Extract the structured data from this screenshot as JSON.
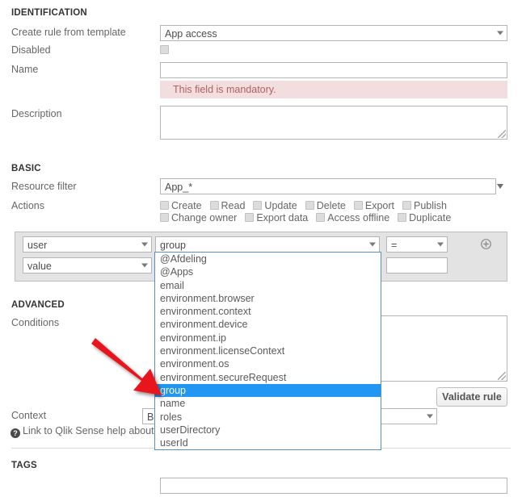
{
  "sections": {
    "identification": "IDENTIFICATION",
    "basic": "BASIC",
    "advanced": "ADVANCED",
    "tags": "TAGS"
  },
  "identification": {
    "template_label": "Create rule from template",
    "template_value": "App access",
    "disabled_label": "Disabled",
    "disabled_checked": false,
    "name_label": "Name",
    "name_value": "",
    "name_error": "This field is mandatory.",
    "description_label": "Description",
    "description_value": ""
  },
  "basic": {
    "resource_filter_label": "Resource filter",
    "resource_filter_value": "App_*",
    "actions_label": "Actions",
    "actions": [
      {
        "label": "Create",
        "checked": false
      },
      {
        "label": "Read",
        "checked": false
      },
      {
        "label": "Update",
        "checked": false
      },
      {
        "label": "Delete",
        "checked": false
      },
      {
        "label": "Export",
        "checked": false
      },
      {
        "label": "Publish",
        "checked": false
      },
      {
        "label": "Change owner",
        "checked": false
      },
      {
        "label": "Export data",
        "checked": false
      },
      {
        "label": "Access offline",
        "checked": false
      },
      {
        "label": "Duplicate",
        "checked": false
      }
    ],
    "condition": {
      "subject_value": "user",
      "property_value": "group",
      "operator_value": "=",
      "value_type_value": "value",
      "value_text": "",
      "add_icon": "plus-circle-icon"
    }
  },
  "property_dropdown": {
    "open": true,
    "selected": "group",
    "options": [
      "@Afdeling",
      "@Apps",
      "email",
      "environment.browser",
      "environment.context",
      "environment.device",
      "environment.ip",
      "environment.licenseContext",
      "environment.os",
      "environment.secureRequest",
      "group",
      "name",
      "roles",
      "userDirectory",
      "userId"
    ]
  },
  "advanced": {
    "conditions_label": "Conditions",
    "conditions_value": "",
    "validate_button": "Validate rule",
    "context_label": "Context",
    "context_value": "Bo",
    "help_text": "Link to Qlik Sense help about s",
    "help_icon": "question-mark-icon"
  },
  "tags": {
    "value": ""
  },
  "colors": {
    "highlight": "#2196f3",
    "error_bg": "#f2dede",
    "error_text": "#b0605f",
    "annotation_arrow": "#e8191a",
    "panel_bg": "#e3e3e3"
  }
}
